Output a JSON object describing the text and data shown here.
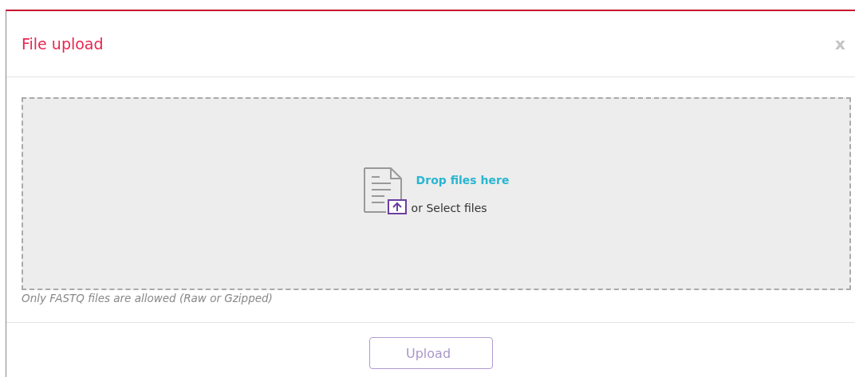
{
  "dialog": {
    "title": "File upload",
    "close": "x"
  },
  "dropzone": {
    "prompt": "Drop files here",
    "secondary": "or Select files"
  },
  "hint": "Only FASTQ files are allowed (Raw or Gzipped)",
  "upload_button": {
    "label": "Upload",
    "disabled": true
  }
}
